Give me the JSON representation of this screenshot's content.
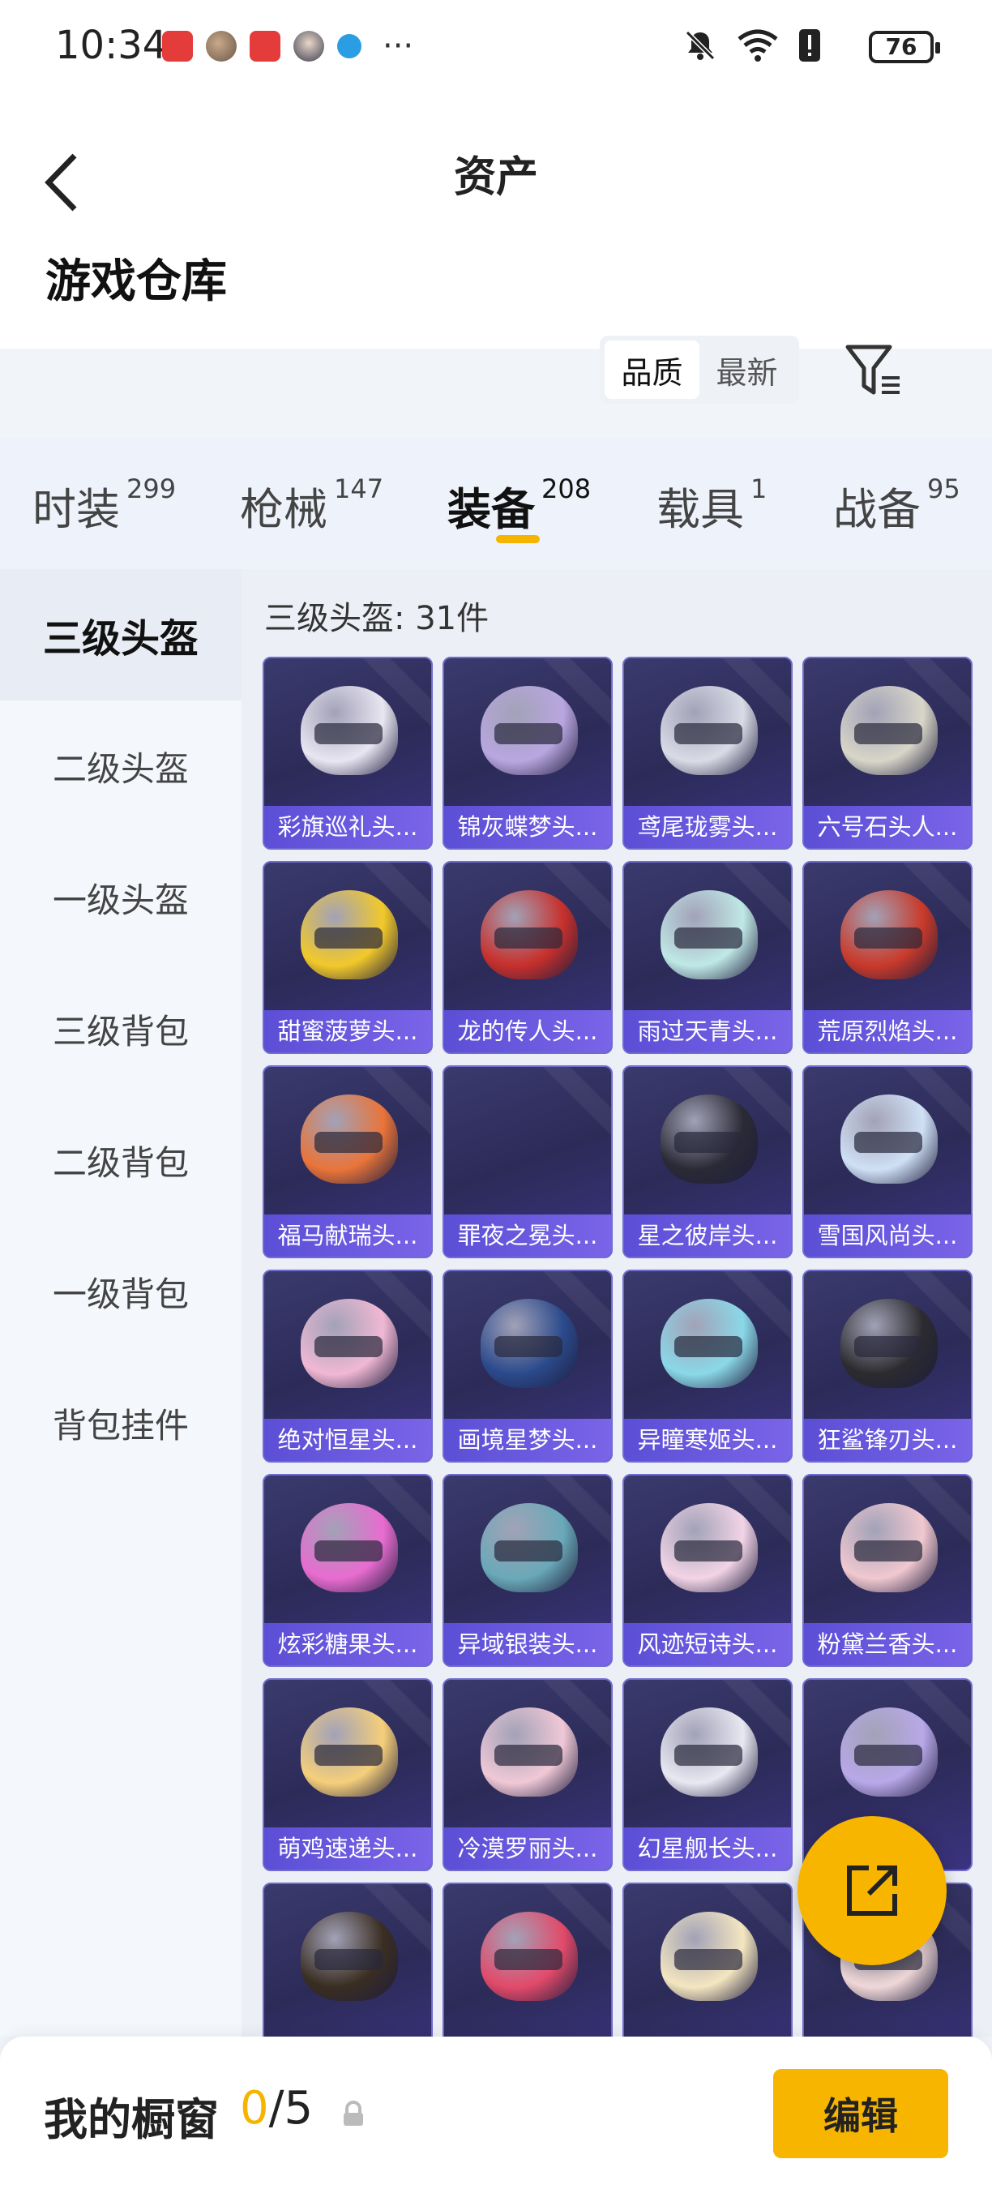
{
  "status_bar": {
    "time": "10:34",
    "battery": "76"
  },
  "header": {
    "title": "资产"
  },
  "warehouse": {
    "title": "游戏仓库",
    "sort_options": [
      "品质",
      "最新"
    ]
  },
  "category_tabs": [
    {
      "label": "时装",
      "count": "299"
    },
    {
      "label": "枪械",
      "count": "147"
    },
    {
      "label": "装备",
      "count": "208"
    },
    {
      "label": "载具",
      "count": "1"
    },
    {
      "label": "战备",
      "count": "95"
    }
  ],
  "sidebar": {
    "items": [
      "三级头盔",
      "二级头盔",
      "一级头盔",
      "三级背包",
      "二级背包",
      "一级背包",
      "背包挂件"
    ]
  },
  "grid": {
    "title": "三级头盔: 31件",
    "items": [
      "彩旗巡礼头...",
      "锦灰蝶梦头...",
      "鸢尾珑雾头...",
      "六号石头人...",
      "甜蜜菠萝头...",
      "龙的传人头...",
      "雨过天青头...",
      "荒原烈焰头...",
      "福马献瑞头...",
      "罪夜之冕头...",
      "星之彼岸头...",
      "雪国风尚头...",
      "绝对恒星头...",
      "画境星梦头...",
      "异瞳寒姬头...",
      "狂鲨锋刃头...",
      "炫彩糖果头...",
      "异域银装头...",
      "风迹短诗头...",
      "粉黛兰香头...",
      "萌鸡速递头...",
      "冷漠罗丽头...",
      "幻星舰长头...",
      "",
      "",
      "",
      "",
      ""
    ],
    "helmet_colors": [
      "#e9e6f2",
      "#b9a6e0",
      "#d9dbe6",
      "#d8d6c8",
      "#f2c92a",
      "#c7302c",
      "#bfe8e6",
      "#c93a2a",
      "#e9743a",
      "",
      "#2a2a36",
      "#cfe0f5",
      "#f0b8d4",
      "#2b4a8c",
      "#8ad8e8",
      "#2b2b2f",
      "#e86cd0",
      "#6aa9b8",
      "#f2d4e6",
      "#f0c8d0",
      "#f5cf7a",
      "#f0c8d6",
      "#e8e8f2",
      "#b8a8e8",
      "#3a2e22",
      "#e24a6a",
      "#f4e6c0",
      "#f0d8d8"
    ]
  },
  "bottom_bar": {
    "showcase_label": "我的橱窗",
    "showcase_current": "0",
    "showcase_total": "/5",
    "edit_label": "编辑"
  }
}
